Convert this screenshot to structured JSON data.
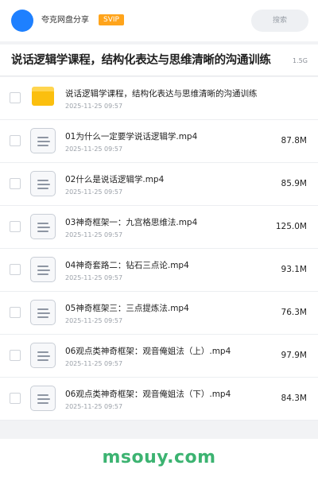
{
  "header": {
    "app_name": "夸克网盘分享",
    "badge": "SVIP",
    "search_placeholder": "搜索"
  },
  "title_bar": {
    "title": "说话逻辑学课程，结构化表达与思维清晰的沟通训练",
    "total_size": "1.5G"
  },
  "files": [
    {
      "type": "folder",
      "name": "说话逻辑学课程，结构化表达与思维清晰的沟通训练",
      "date": "2025-11-25 09:57",
      "size": ""
    },
    {
      "type": "file",
      "name": "01为什么一定要学说话逻辑学.mp4",
      "date": "2025-11-25 09:57",
      "size": "87.8M"
    },
    {
      "type": "file",
      "name": "02什么是说话逻辑学.mp4",
      "date": "2025-11-25 09:57",
      "size": "85.9M"
    },
    {
      "type": "file",
      "name": "03神奇框架一：九宫格思维法.mp4",
      "date": "2025-11-25 09:57",
      "size": "125.0M"
    },
    {
      "type": "file",
      "name": "04神奇套路二：钻石三点论.mp4",
      "date": "2025-11-25 09:57",
      "size": "93.1M"
    },
    {
      "type": "file",
      "name": "05神奇框架三：三点提炼法.mp4",
      "date": "2025-11-25 09:57",
      "size": "76.3M"
    },
    {
      "type": "file",
      "name": "06观点类神奇框架：观音俺姐法（上）.mp4",
      "date": "2025-11-25 09:57",
      "size": "97.9M"
    },
    {
      "type": "file",
      "name": "06观点类神奇框架：观音俺姐法（下）.mp4",
      "date": "2025-11-25 09:57",
      "size": "84.3M"
    }
  ],
  "footer": {
    "watermark": "msouy.com"
  },
  "colors": {
    "accent": "#1e80ff",
    "svip": "#ffa41b",
    "folder": "#fbbf0e",
    "watermark": "#3cb371"
  }
}
